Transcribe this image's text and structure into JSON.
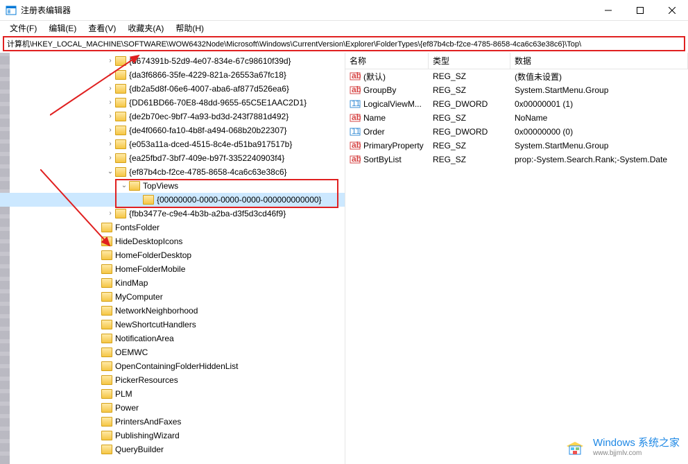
{
  "window": {
    "title": "注册表编辑器"
  },
  "menu": {
    "file": "文件(F)",
    "edit": "编辑(E)",
    "view": "查看(V)",
    "favorites": "收藏夹(A)",
    "help": "帮助(H)"
  },
  "address": {
    "path": "计算机\\HKEY_LOCAL_MACHINE\\SOFTWARE\\WOW6432Node\\Microsoft\\Windows\\CurrentVersion\\Explorer\\FolderTypes\\{ef87b4cb-f2ce-4785-8658-4ca6c63e38c6}\\Top\\"
  },
  "columns": {
    "name": "名称",
    "type": "类型",
    "data": "数据"
  },
  "tree": [
    {
      "indent": 152,
      "exp": ">",
      "label": "{d674391b-52d9-4e07-834e-67c98610f39d}"
    },
    {
      "indent": 152,
      "exp": ">",
      "label": "{da3f6866-35fe-4229-821a-26553a67fc18}"
    },
    {
      "indent": 152,
      "exp": ">",
      "label": "{db2a5d8f-06e6-4007-aba6-af877d526ea6}"
    },
    {
      "indent": 152,
      "exp": ">",
      "label": "{DD61BD66-70E8-48dd-9655-65C5E1AAC2D1}"
    },
    {
      "indent": 152,
      "exp": ">",
      "label": "{de2b70ec-9bf7-4a93-bd3d-243f7881d492}"
    },
    {
      "indent": 152,
      "exp": ">",
      "label": "{de4f0660-fa10-4b8f-a494-068b20b22307}"
    },
    {
      "indent": 152,
      "exp": ">",
      "label": "{e053a11a-dced-4515-8c4e-d51ba917517b}"
    },
    {
      "indent": 152,
      "exp": ">",
      "label": "{ea25fbd7-3bf7-409e-b97f-3352240903f4}"
    },
    {
      "indent": 152,
      "exp": "v",
      "label": "{ef87b4cb-f2ce-4785-8658-4ca6c63e38c6}"
    },
    {
      "indent": 172,
      "exp": "v",
      "label": "TopViews"
    },
    {
      "indent": 192,
      "exp": "",
      "label": "{00000000-0000-0000-0000-000000000000}",
      "sel": true
    },
    {
      "indent": 152,
      "exp": ">",
      "label": "{fbb3477e-c9e4-4b3b-a2ba-d3f5d3cd46f9}"
    },
    {
      "indent": 132,
      "exp": "",
      "label": "FontsFolder"
    },
    {
      "indent": 132,
      "exp": "",
      "label": "HideDesktopIcons"
    },
    {
      "indent": 132,
      "exp": "",
      "label": "HomeFolderDesktop"
    },
    {
      "indent": 132,
      "exp": "",
      "label": "HomeFolderMobile"
    },
    {
      "indent": 132,
      "exp": "",
      "label": "KindMap"
    },
    {
      "indent": 132,
      "exp": "",
      "label": "MyComputer"
    },
    {
      "indent": 132,
      "exp": "",
      "label": "NetworkNeighborhood"
    },
    {
      "indent": 132,
      "exp": "",
      "label": "NewShortcutHandlers"
    },
    {
      "indent": 132,
      "exp": "",
      "label": "NotificationArea"
    },
    {
      "indent": 132,
      "exp": "",
      "label": "OEMWC"
    },
    {
      "indent": 132,
      "exp": "",
      "label": "OpenContainingFolderHiddenList"
    },
    {
      "indent": 132,
      "exp": "",
      "label": "PickerResources"
    },
    {
      "indent": 132,
      "exp": "",
      "label": "PLM"
    },
    {
      "indent": 132,
      "exp": "",
      "label": "Power"
    },
    {
      "indent": 132,
      "exp": "",
      "label": "PrintersAndFaxes"
    },
    {
      "indent": 132,
      "exp": "",
      "label": "PublishingWizard"
    },
    {
      "indent": 132,
      "exp": "",
      "label": "QueryBuilder"
    }
  ],
  "values": [
    {
      "icon": "str",
      "name": "(默认)",
      "type": "REG_SZ",
      "data": "(数值未设置)"
    },
    {
      "icon": "str",
      "name": "GroupBy",
      "type": "REG_SZ",
      "data": "System.StartMenu.Group"
    },
    {
      "icon": "bin",
      "name": "LogicalViewM...",
      "type": "REG_DWORD",
      "data": "0x00000001 (1)"
    },
    {
      "icon": "str",
      "name": "Name",
      "type": "REG_SZ",
      "data": "NoName"
    },
    {
      "icon": "bin",
      "name": "Order",
      "type": "REG_DWORD",
      "data": "0x00000000 (0)"
    },
    {
      "icon": "str",
      "name": "PrimaryProperty",
      "type": "REG_SZ",
      "data": "System.StartMenu.Group"
    },
    {
      "icon": "str",
      "name": "SortByList",
      "type": "REG_SZ",
      "data": "prop:-System.Search.Rank;-System.Date"
    }
  ],
  "watermark": {
    "line1": "Windows 系统之家",
    "line2": "www.bjjmlv.com"
  }
}
